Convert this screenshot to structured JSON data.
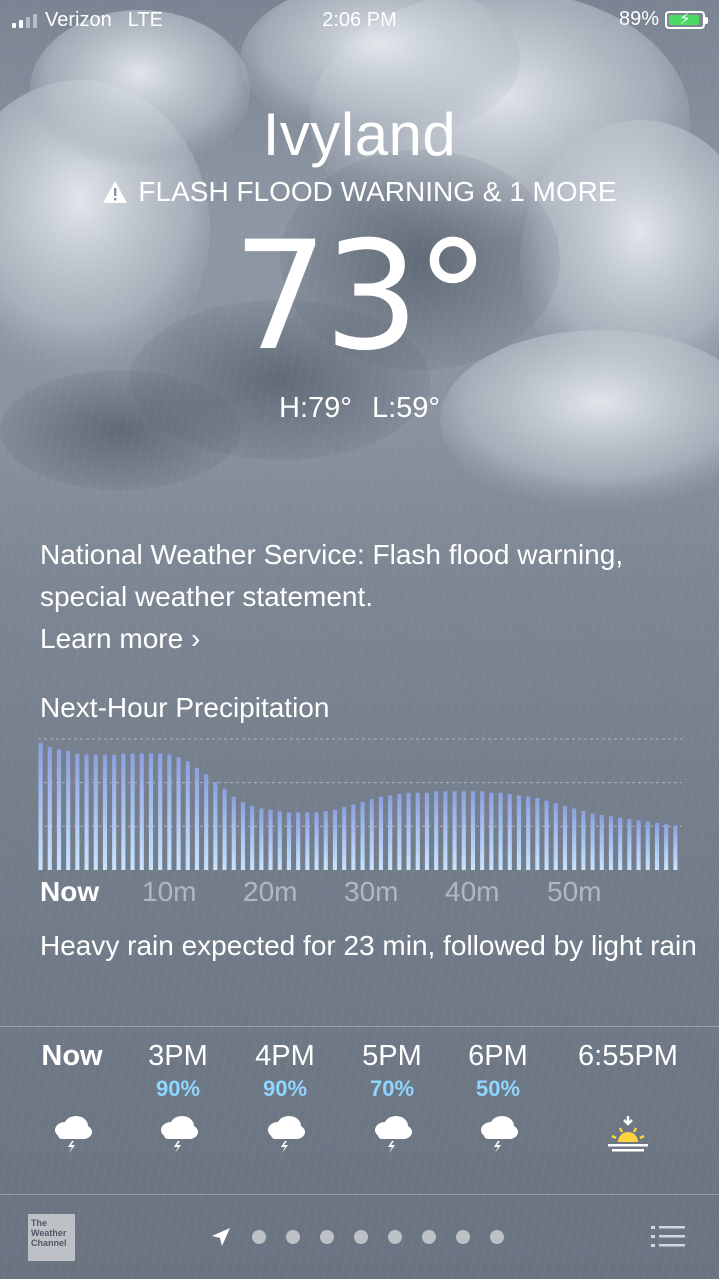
{
  "status_bar": {
    "carrier": "Verizon",
    "network": "LTE",
    "time": "2:06 PM",
    "battery": "89%",
    "battery_charging": true
  },
  "location": {
    "city": "Ivyland",
    "alert_text": "FLASH FLOOD WARNING & 1 MORE",
    "temperature": "73°",
    "high": "H:79°",
    "low": "L:59°"
  },
  "notice": {
    "text": "National Weather Service: Flash flood warning, special weather statement.",
    "learn_more": "Learn more ›"
  },
  "precipitation": {
    "title": "Next-Hour Precipitation",
    "ticks": [
      "Now",
      "10m",
      "20m",
      "30m",
      "40m",
      "50m"
    ],
    "summary": "Heavy rain expected for 23 min, followed by light rain"
  },
  "chart_data": {
    "type": "bar",
    "title": "Next-Hour Precipitation",
    "x": [
      "Now",
      "10m",
      "20m",
      "30m",
      "40m",
      "50m"
    ],
    "values": [
      0.97,
      0.94,
      0.92,
      0.91,
      0.89,
      0.88,
      0.88,
      0.88,
      0.88,
      0.89,
      0.89,
      0.89,
      0.89,
      0.89,
      0.88,
      0.86,
      0.83,
      0.78,
      0.73,
      0.67,
      0.62,
      0.56,
      0.52,
      0.49,
      0.47,
      0.46,
      0.45,
      0.44,
      0.44,
      0.44,
      0.44,
      0.45,
      0.46,
      0.48,
      0.5,
      0.52,
      0.54,
      0.56,
      0.57,
      0.58,
      0.59,
      0.59,
      0.59,
      0.6,
      0.6,
      0.6,
      0.6,
      0.6,
      0.6,
      0.59,
      0.59,
      0.58,
      0.57,
      0.56,
      0.55,
      0.53,
      0.51,
      0.49,
      0.47,
      0.45,
      0.43,
      0.42,
      0.41,
      0.4,
      0.39,
      0.38,
      0.37,
      0.36,
      0.35,
      0.34
    ],
    "levels": [
      "heavy",
      "moderate",
      "light"
    ],
    "grid": true
  },
  "hourly": [
    {
      "label": "Now",
      "precip": "",
      "icon": "thunderstorm-icon"
    },
    {
      "label": "3PM",
      "precip": "90%",
      "icon": "thunderstorm-icon"
    },
    {
      "label": "4PM",
      "precip": "90%",
      "icon": "thunderstorm-icon"
    },
    {
      "label": "5PM",
      "precip": "70%",
      "icon": "thunderstorm-icon"
    },
    {
      "label": "6PM",
      "precip": "50%",
      "icon": "thunderstorm-icon"
    },
    {
      "label": "6:55PM",
      "precip": "",
      "icon": "sunset-icon"
    }
  ],
  "footer": {
    "brand": "The Weather Channel",
    "page_dots": 8,
    "colors": {
      "dot": "#ffffff",
      "precip_text": "#8ed6ff",
      "bar_top": "#8aa0e0",
      "bar_bottom": "#c8e4ff"
    }
  }
}
